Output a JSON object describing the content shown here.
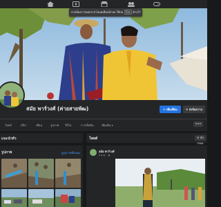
{
  "nav": {
    "icons": [
      "home-icon",
      "video-icon",
      "marketplace-icon",
      "groups-icon",
      "gaming-icon"
    ],
    "tooltip": {
      "text": "หากต้องการออกจากโหมดเต็มหน้าจอ ให้กด",
      "key": "Esc",
      "suffix": "ค้างไว้"
    }
  },
  "profile": {
    "name": "สมัย พาร์วงศ์ (ค่ายสายพัฒ)",
    "add_friend": "เพิ่มเพื่อน",
    "message": "ส่งข้อความ"
  },
  "tabs": [
    "โพสต์",
    "เกี่ยว",
    "เพื่อน",
    "รูปภาพ",
    "วิดีโอ",
    "การเช็คอิน",
    "เพิ่มเติม"
  ],
  "more_icon": "•••",
  "intro": {
    "title": "แนะนำตัว"
  },
  "photos": {
    "title": "รูปภาพ",
    "see_all": "ดูรูปภาพทั้งหมด"
  },
  "posts": {
    "title": "โพสต์",
    "filter": "ตัวกรอง"
  },
  "post": {
    "author": "สมัย พาร์วงศ์",
    "time": "4 ธ.ค."
  },
  "colors": {
    "accent": "#2374e1",
    "background": "#18191a",
    "card": "#242526"
  }
}
